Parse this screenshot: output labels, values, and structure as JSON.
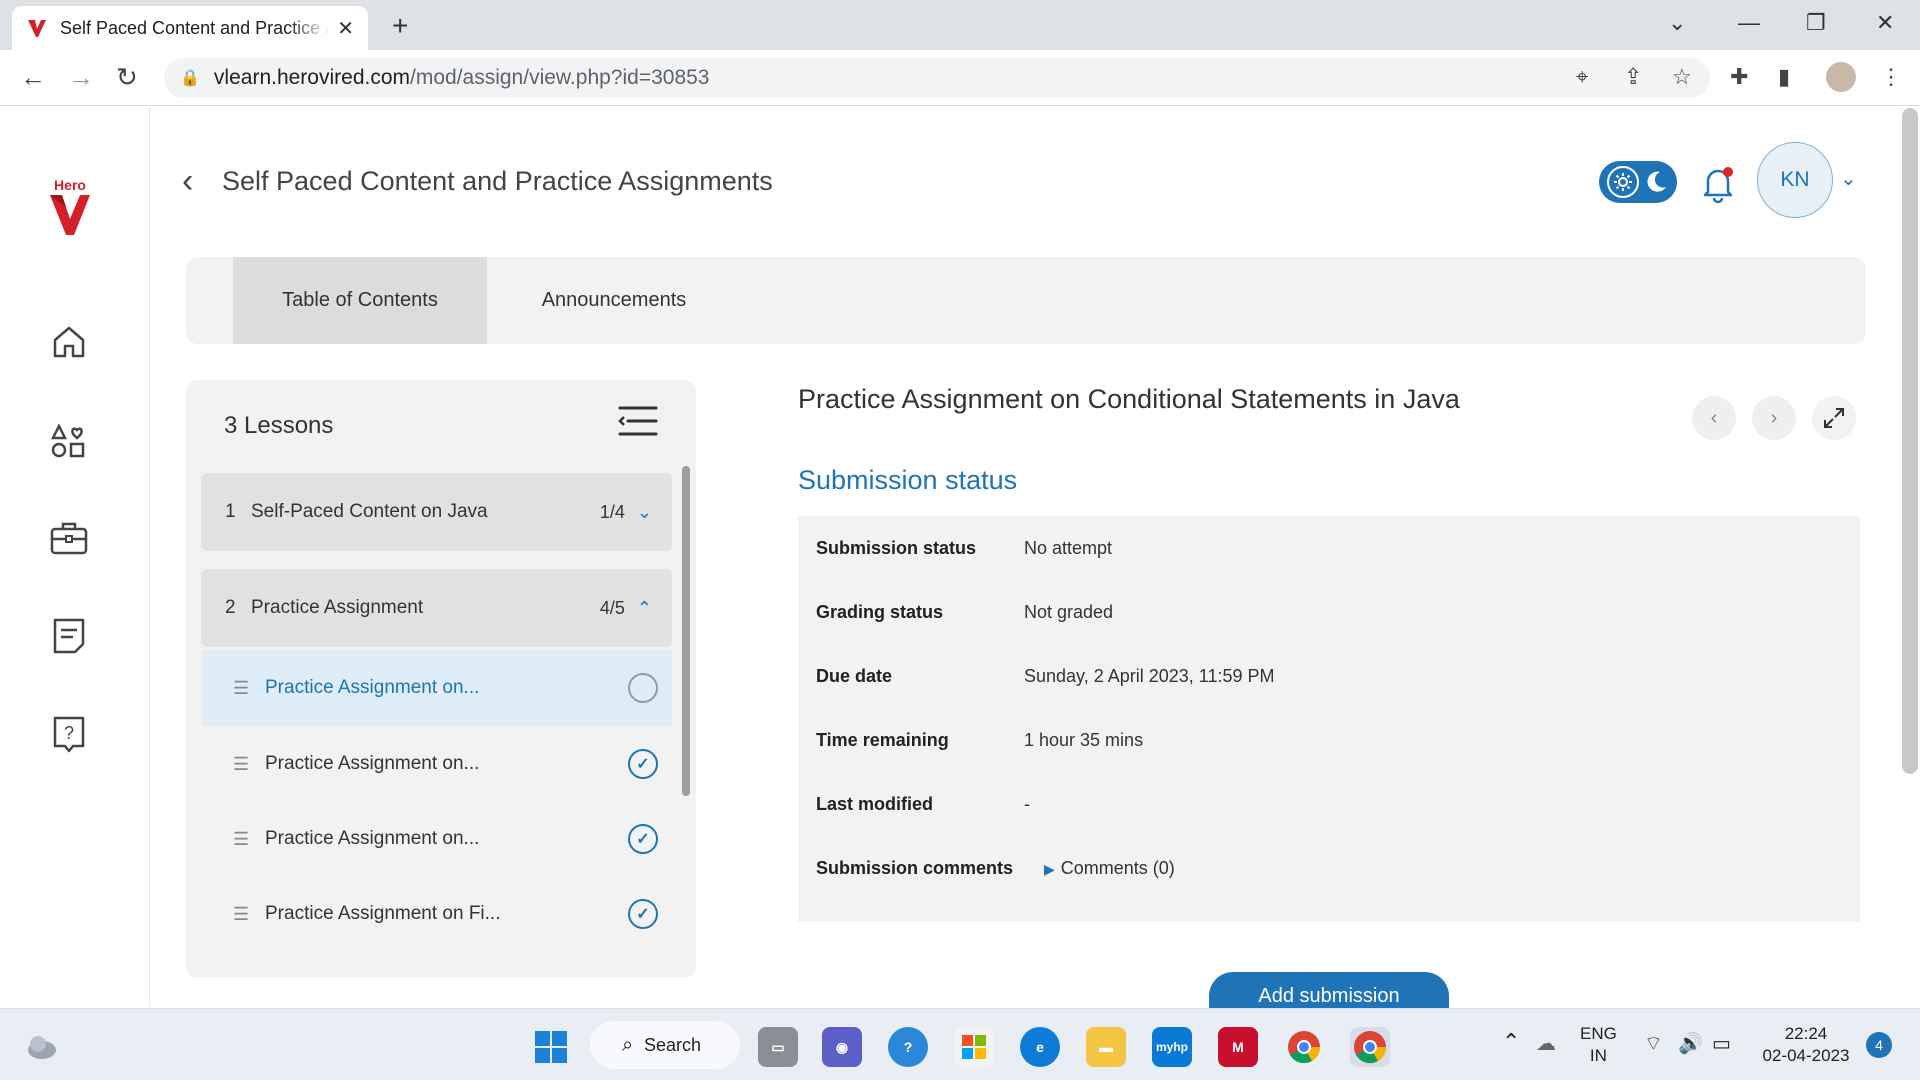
{
  "browser": {
    "tab_title": "Self Paced Content and Practice Assignments",
    "url_host": "vlearn.herovired.com",
    "url_path": "/mod/assign/view.php?id=30853"
  },
  "brand": {
    "logo_text": "Hero",
    "accent": "#d31f26"
  },
  "header": {
    "course_title": "Self Paced Content and Practice Assignments",
    "user_initials": "KN"
  },
  "tabs": [
    {
      "label": "Table of Contents",
      "active": true
    },
    {
      "label": "Announcements",
      "active": false
    }
  ],
  "lessons": {
    "title": "3 Lessons",
    "groups": [
      {
        "num": "1",
        "name": "Self-Paced Content on Java",
        "count": "1/4",
        "expanded": false
      },
      {
        "num": "2",
        "name": "Practice Assignment",
        "count": "4/5",
        "expanded": true
      }
    ],
    "items": [
      {
        "label": "Practice Assignment on...",
        "status": "incomplete",
        "active": true
      },
      {
        "label": "Practice Assignment on...",
        "status": "complete",
        "active": false
      },
      {
        "label": "Practice Assignment on...",
        "status": "complete",
        "active": false
      },
      {
        "label": "Practice Assignment on Fi...",
        "status": "complete",
        "active": false
      }
    ]
  },
  "assignment": {
    "title": "Practice Assignment on Conditional Statements in Java",
    "section_heading": "Submission status",
    "rows": [
      {
        "key": "Submission status",
        "value": "No attempt"
      },
      {
        "key": "Grading status",
        "value": "Not graded"
      },
      {
        "key": "Due date",
        "value": "Sunday, 2 April 2023, 11:59 PM"
      },
      {
        "key": "Time remaining",
        "value": "1 hour 35 mins"
      },
      {
        "key": "Last modified",
        "value": "-"
      },
      {
        "key": "Submission comments",
        "value": "Comments (0)"
      }
    ],
    "add_button": "Add submission"
  },
  "taskbar": {
    "search_label": "Search",
    "lang_top": "ENG",
    "lang_bottom": "IN",
    "time": "22:24",
    "date": "02-04-2023",
    "notifications": "4",
    "hp_label": "myhp"
  },
  "colors": {
    "primary": "#1f73b7",
    "panel": "#f2f2f2"
  }
}
